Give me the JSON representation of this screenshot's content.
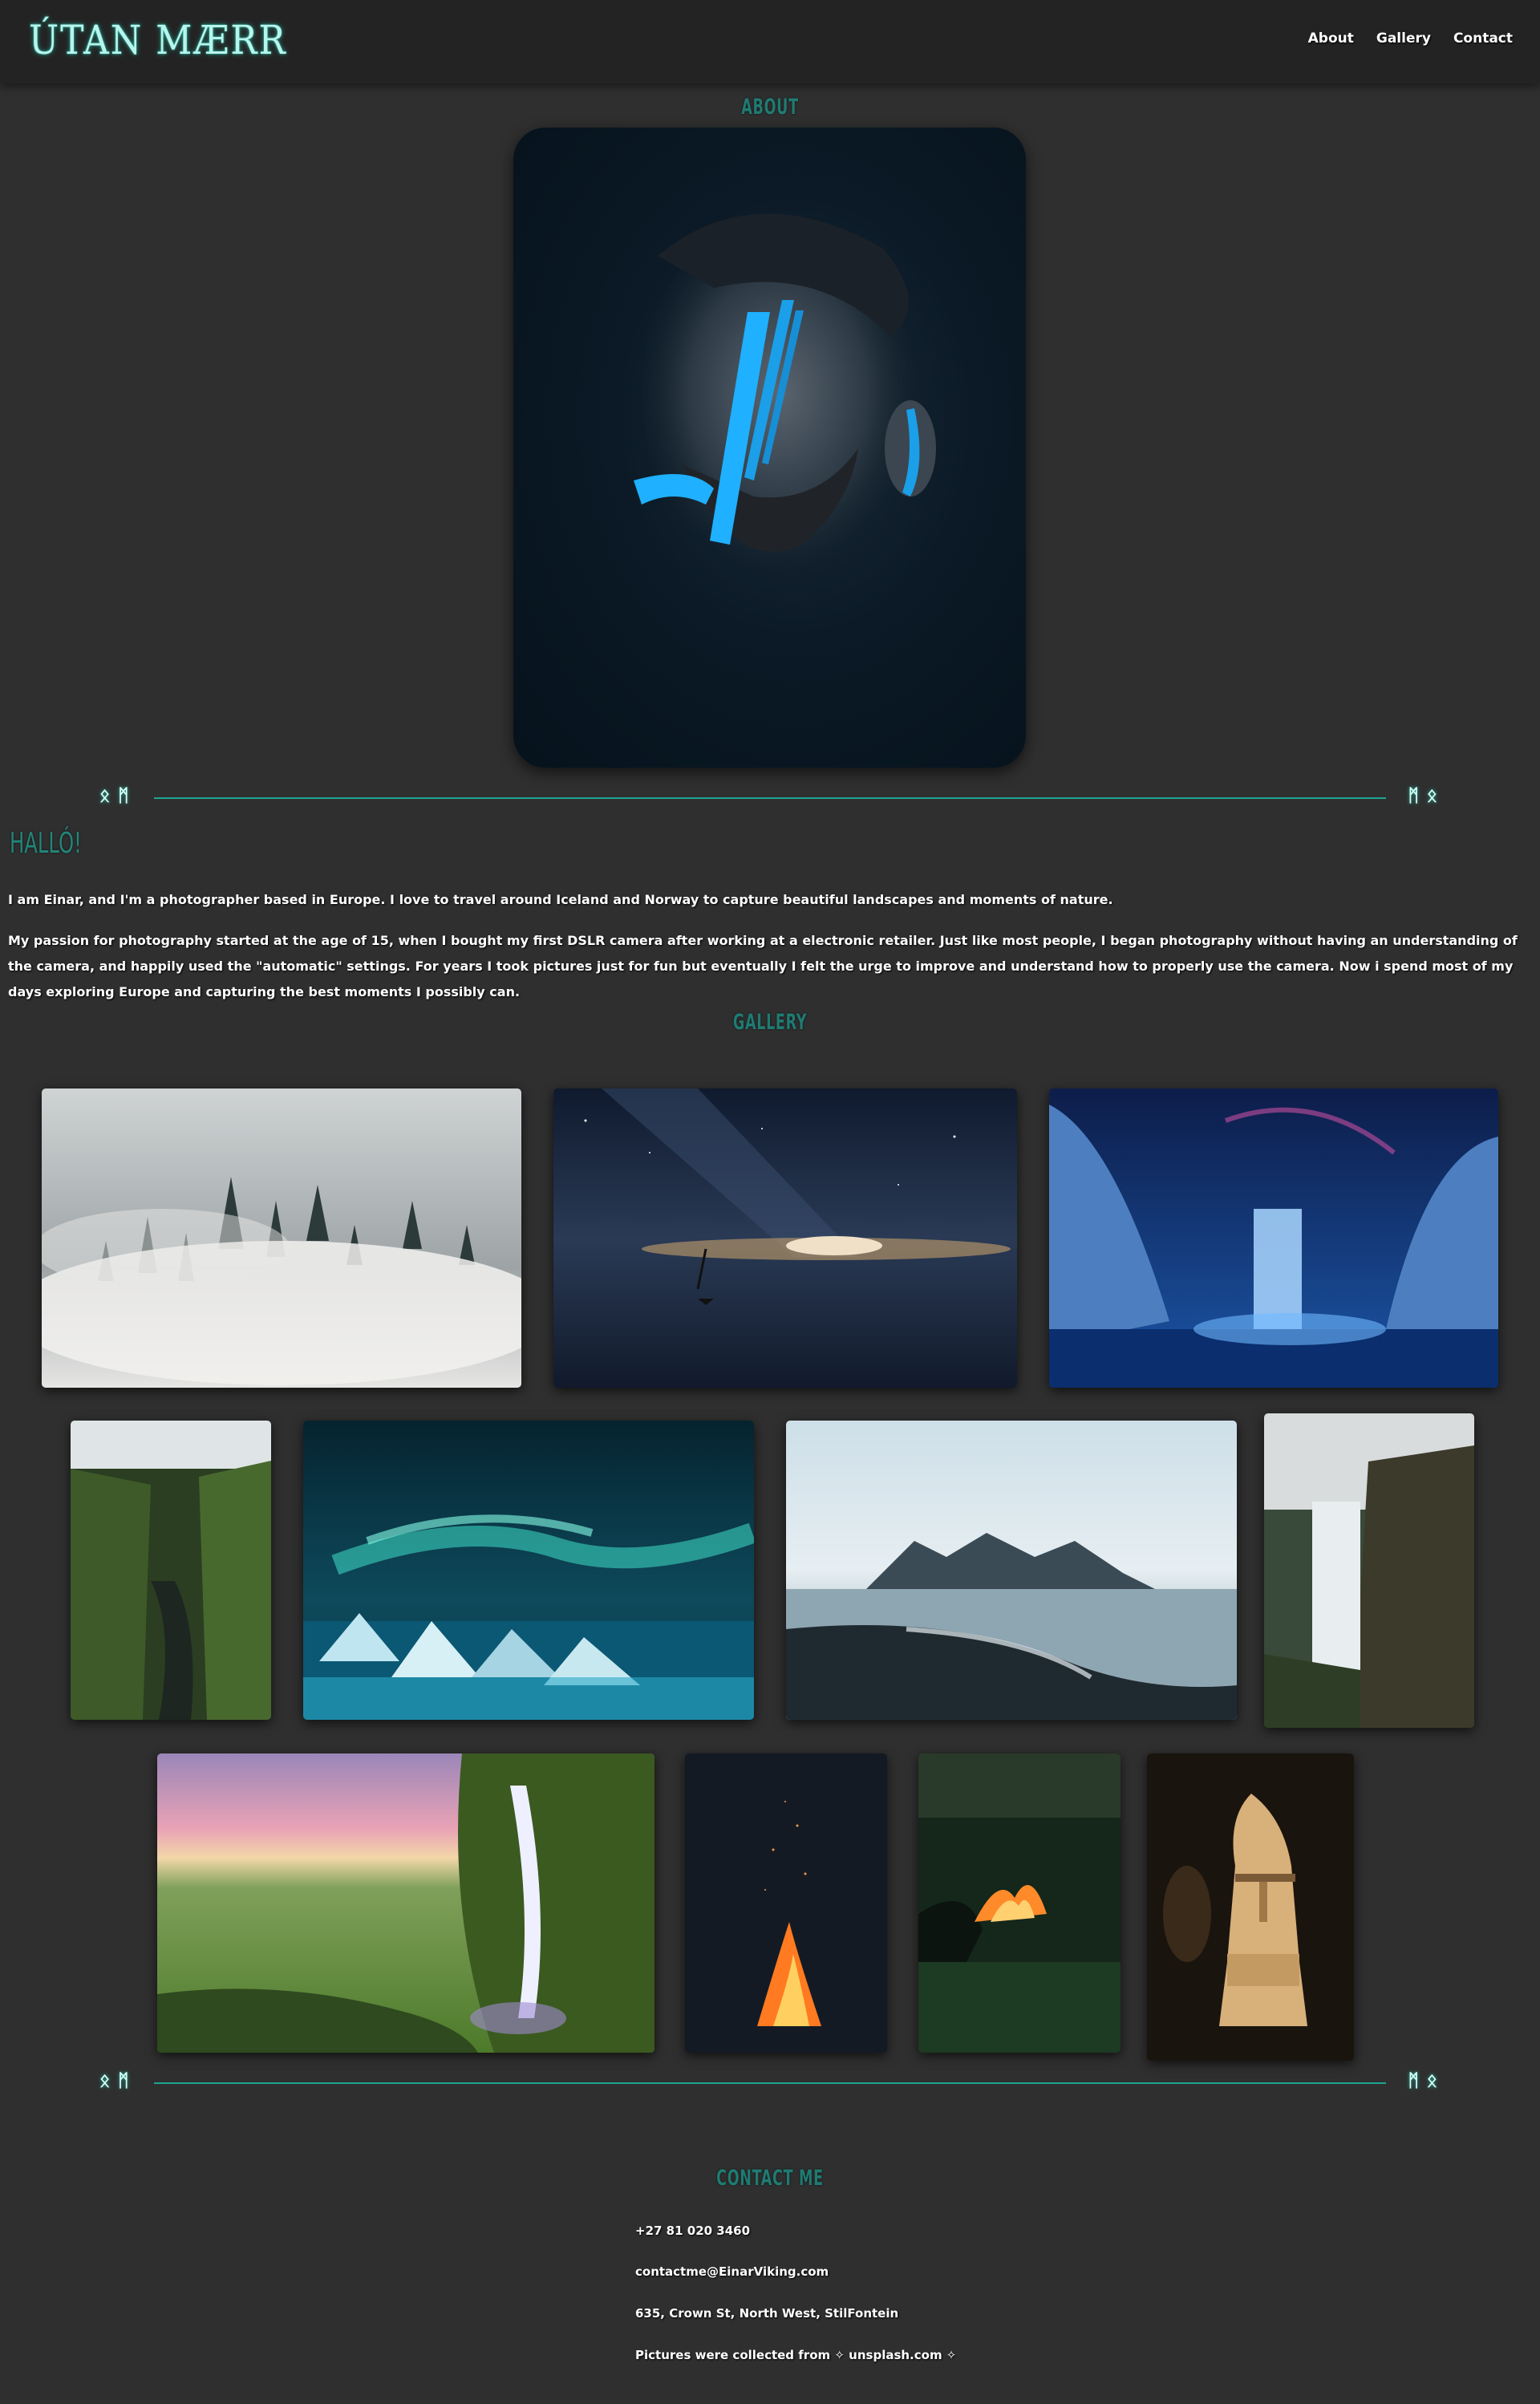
{
  "header": {
    "brand": "ÚTAN MÆRR",
    "nav": [
      "About",
      "Gallery",
      "Contact"
    ]
  },
  "about": {
    "heading": "ABOUT",
    "greeting": "HALLÓ!",
    "paragraph_1": "I am Einar, and I'm a photographer based in Europe. I love to travel around Iceland and Norway to capture beautiful landscapes and moments of nature.",
    "paragraph_2": "My passion for photography started at the age of 15, when I bought my first DSLR camera after working at a electronic retailer. Just like most people, I began photography without having an understanding of the camera, and happily used the \"automatic\" settings. For years I took pictures just for fun but eventually I felt the urge to improve and understand how to properly use the camera. Now i spend most of my days exploring Europe and capturing the best moments I possibly can."
  },
  "divider": {
    "runes_left": "ᛟᛗ",
    "runes_right": "ᛗᛟ"
  },
  "gallery": {
    "heading": "GALLERY",
    "photos": [
      "misty-forest",
      "night-sailboat",
      "ice-cave-waterfall",
      "green-canyon",
      "aurora-ice",
      "mountain-beach",
      "cliff-waterfall",
      "sunset-waterfall",
      "night-campfire",
      "forest-campfire",
      "wooden-statue"
    ]
  },
  "contact": {
    "heading": "CONTACT ME",
    "phone": "+27 81 020 3460",
    "email": "contactme@EinarViking.com",
    "address": "635, Crown St, North West, StilFontein",
    "credit_prefix": "Pictures were collected from",
    "credit_link": "✧ unsplash.com ✧"
  },
  "colors": {
    "background": "#2f2f2f",
    "header": "#232323",
    "accent": "#1ea592",
    "heading": "#1f7b72"
  }
}
